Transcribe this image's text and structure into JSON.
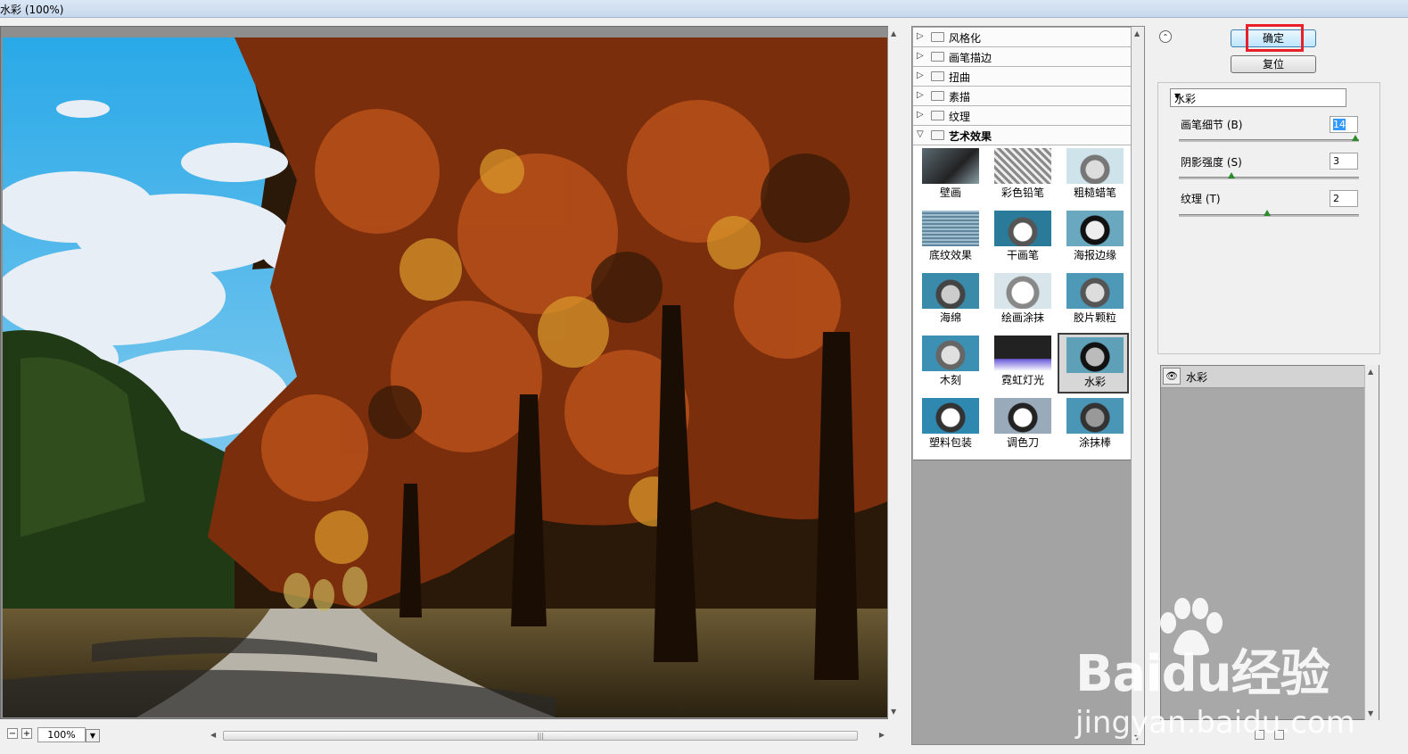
{
  "window": {
    "title": "水彩 (100%)"
  },
  "filters": {
    "categories": [
      {
        "label": "风格化",
        "open": false
      },
      {
        "label": "画笔描边",
        "open": false
      },
      {
        "label": "扭曲",
        "open": false
      },
      {
        "label": "素描",
        "open": false
      },
      {
        "label": "纹理",
        "open": false
      },
      {
        "label": "艺术效果",
        "open": true
      }
    ],
    "thumbnails": [
      {
        "label": "壁画"
      },
      {
        "label": "彩色铅笔"
      },
      {
        "label": "粗糙蜡笔"
      },
      {
        "label": "底纹效果"
      },
      {
        "label": "干画笔"
      },
      {
        "label": "海报边缘"
      },
      {
        "label": "海绵"
      },
      {
        "label": "绘画涂抹"
      },
      {
        "label": "胶片颗粒"
      },
      {
        "label": "木刻"
      },
      {
        "label": "霓虹灯光"
      },
      {
        "label": "水彩",
        "selected": true
      },
      {
        "label": "塑料包装"
      },
      {
        "label": "调色刀"
      },
      {
        "label": "涂抹棒"
      }
    ]
  },
  "buttons": {
    "ok": "确定",
    "reset": "复位"
  },
  "settings": {
    "selected_filter": "水彩",
    "params": [
      {
        "label": "画笔细节 (B)",
        "value": "14",
        "fraction": 1.0
      },
      {
        "label": "阴影强度 (S)",
        "value": "3",
        "fraction": 0.3
      },
      {
        "label": "纹理 (T)",
        "value": "2",
        "fraction": 0.5
      }
    ]
  },
  "layers": {
    "items": [
      {
        "label": "水彩",
        "visible": true
      }
    ]
  },
  "zoom": {
    "value": "100%"
  },
  "watermark": {
    "brand": "Baidu经验",
    "url": "jingyan.baidu.com"
  },
  "colors": {
    "accent": "#3c7fb1",
    "highlight": "#e8202a"
  }
}
